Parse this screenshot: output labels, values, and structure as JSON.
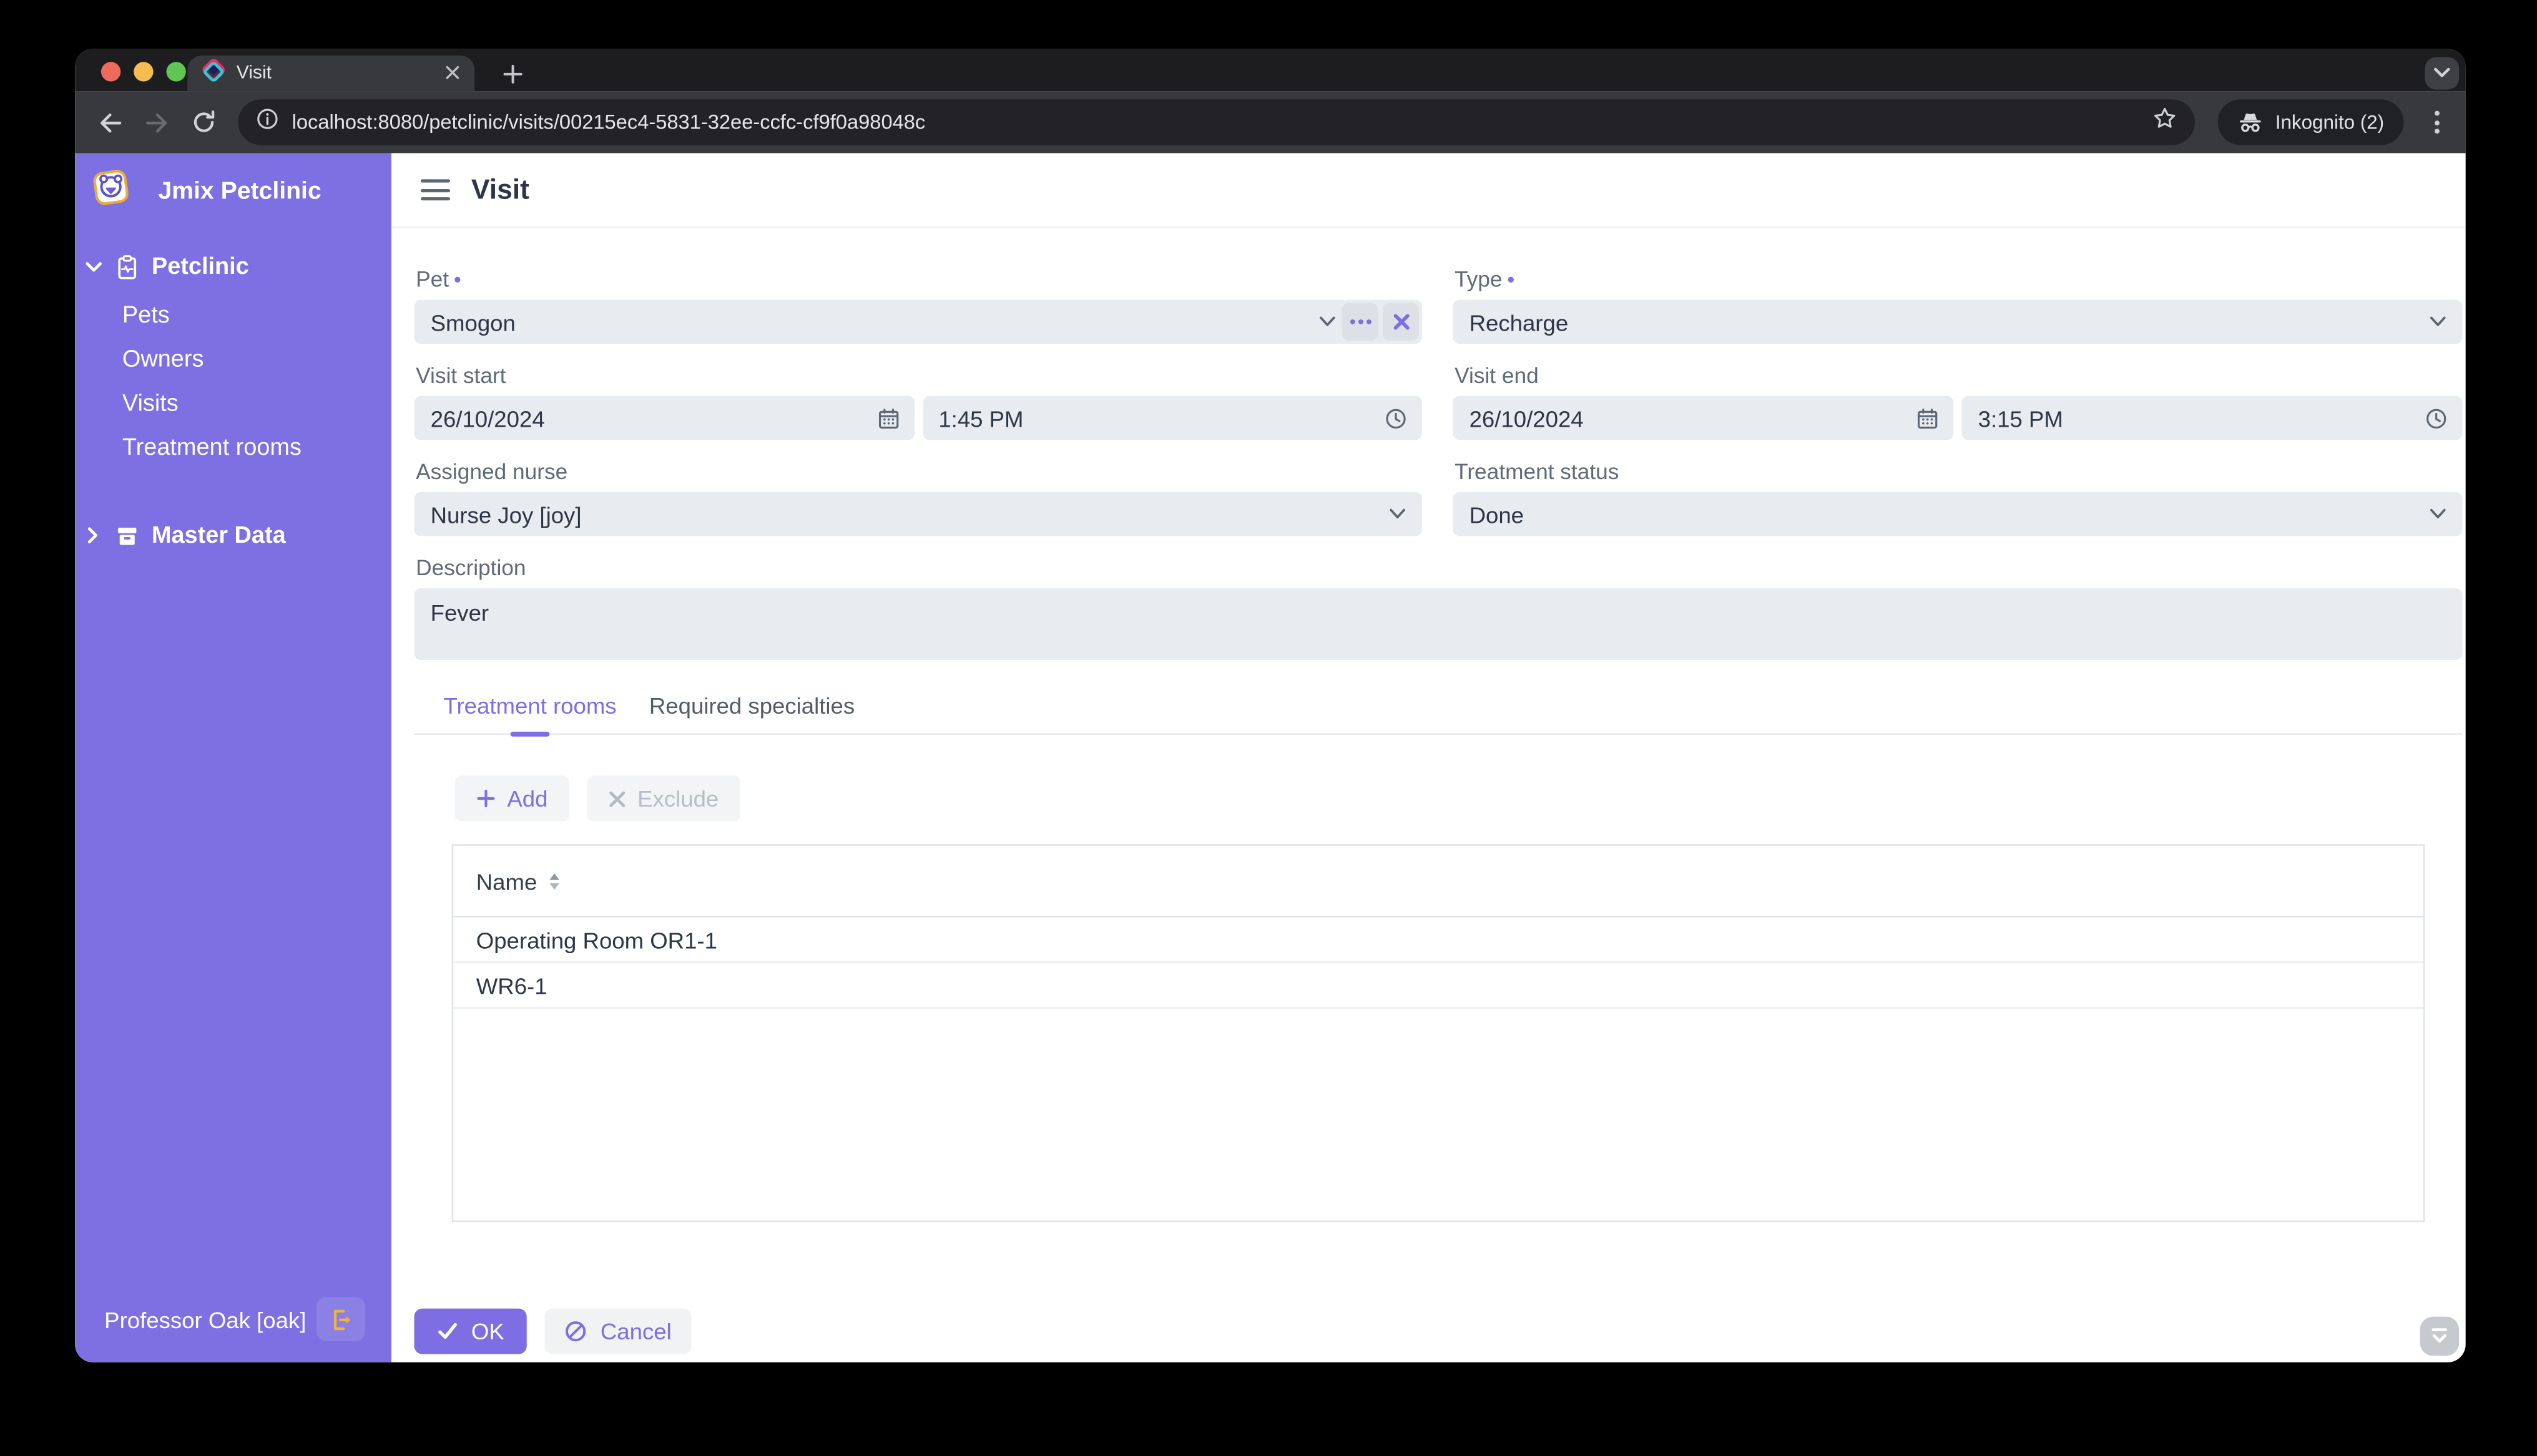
{
  "browser": {
    "tab_title": "Visit",
    "url": "localhost:8080/petclinic/visits/00215ec4-5831-32ee-ccfc-cf9f0a98048c",
    "incognito_label": "Inkognito (2)"
  },
  "sidebar": {
    "app_title": "Jmix Petclinic",
    "sections": [
      {
        "label": "Petclinic",
        "items": [
          "Pets",
          "Owners",
          "Visits",
          "Treatment rooms"
        ]
      },
      {
        "label": "Master Data",
        "items": []
      }
    ],
    "user": {
      "name": "Professor Oak [oak]"
    }
  },
  "page": {
    "title": "Visit"
  },
  "form": {
    "required_marker": "•",
    "pet": {
      "label": "Pet",
      "value": "Smogon"
    },
    "type": {
      "label": "Type",
      "value": "Recharge"
    },
    "visit_start": {
      "label": "Visit start",
      "date": "26/10/2024",
      "time": "1:45 PM"
    },
    "visit_end": {
      "label": "Visit end",
      "date": "26/10/2024",
      "time": "3:15 PM"
    },
    "assigned_nurse": {
      "label": "Assigned nurse",
      "value": "Nurse Joy [joy]"
    },
    "treatment_status": {
      "label": "Treatment status",
      "value": "Done"
    },
    "description": {
      "label": "Description",
      "value": "Fever"
    }
  },
  "tabs": {
    "active": "Treatment rooms",
    "items": [
      "Treatment rooms",
      "Required specialties"
    ]
  },
  "rooms_toolbar": {
    "add_label": "Add",
    "exclude_label": "Exclude"
  },
  "rooms_table": {
    "columns": [
      "Name"
    ],
    "rows": [
      "Operating Room OR1-1",
      "WR6-1"
    ]
  },
  "actions": {
    "ok_label": "OK",
    "cancel_label": "Cancel"
  },
  "colors": {
    "accent": "#7d6ee3",
    "sidebar": "#7c70e2",
    "field_bg": "#e8ebef",
    "logout_icon": "#f2b23e"
  }
}
